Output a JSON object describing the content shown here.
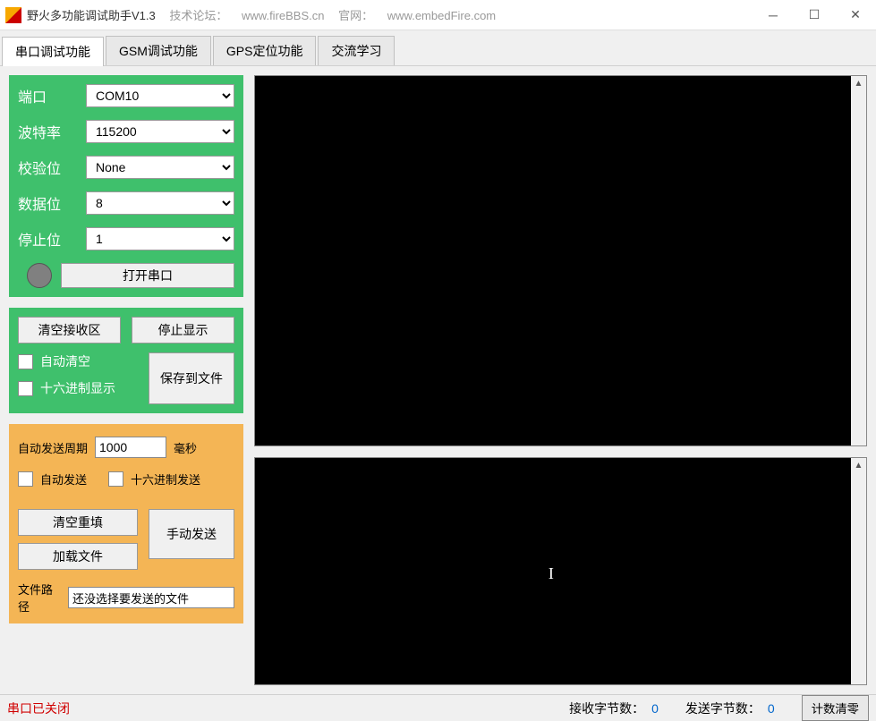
{
  "title": {
    "app_name": "野火多功能调试助手V1.3",
    "forum_label": "技术论坛：",
    "forum_url": "www.fireBBS.cn",
    "site_label": "官网：",
    "site_url": "www.embedFire.com"
  },
  "tabs": {
    "serial": "串口调试功能",
    "gsm": "GSM调试功能",
    "gps": "GPS定位功能",
    "chat": "交流学习"
  },
  "config": {
    "port_label": "端口",
    "port_value": "COM10",
    "baud_label": "波特率",
    "baud_value": "115200",
    "parity_label": "校验位",
    "parity_value": "None",
    "data_label": "数据位",
    "data_value": "8",
    "stop_label": "停止位",
    "stop_value": "1",
    "open_btn": "打开串口"
  },
  "rx": {
    "clear_btn": "清空接收区",
    "stop_btn": "停止显示",
    "auto_clear": "自动清空",
    "hex_display": "十六进制显示",
    "save_btn": "保存到文件"
  },
  "tx": {
    "period_label": "自动发送周期",
    "period_value": "1000",
    "period_unit": "毫秒",
    "auto_send": "自动发送",
    "hex_send": "十六进制发送",
    "clear_btn": "清空重填",
    "load_btn": "加载文件",
    "manual_btn": "手动发送",
    "file_label": "文件路径",
    "file_value": "还没选择要发送的文件"
  },
  "status": {
    "closed": "串口已关闭",
    "rx_label": "接收字节数：",
    "rx_count": "0",
    "tx_label": "发送字节数：",
    "tx_count": "0",
    "reset_btn": "计数清零"
  }
}
